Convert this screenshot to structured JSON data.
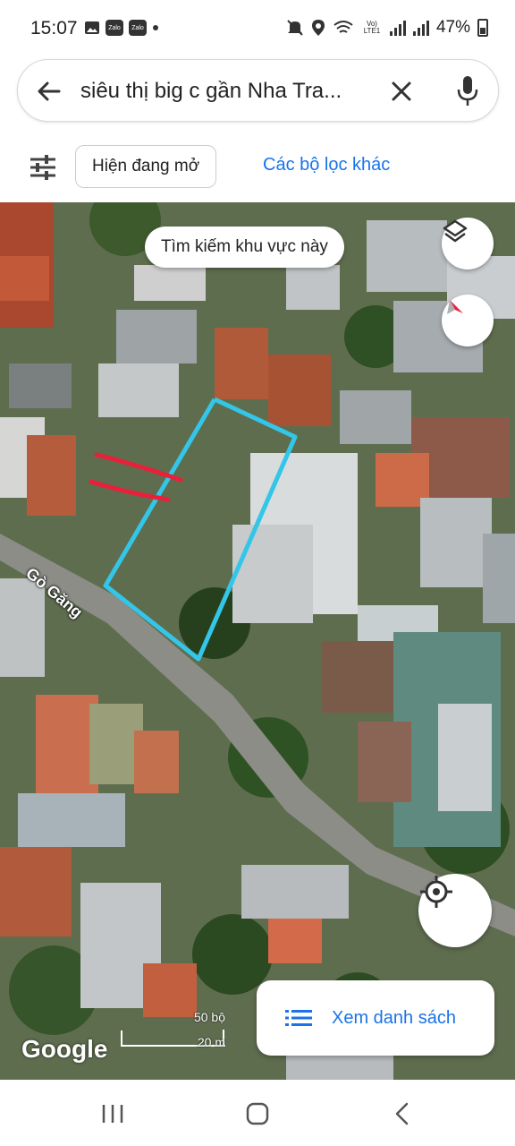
{
  "status": {
    "time": "15:07",
    "left_icons": [
      "image-icon",
      "zalo-icon",
      "zalo-icon",
      "dot-icon"
    ],
    "zalo_text": "Zalo",
    "network": "Vo) LTE1",
    "battery": "47%"
  },
  "search": {
    "query": "siêu thị big c gần Nha Tra...",
    "back_icon": "arrow-back-icon",
    "clear_icon": "close-icon",
    "mic_icon": "mic-icon"
  },
  "filters": {
    "icon": "tune-icon",
    "chip_open_now": "Hiện đang mở",
    "more_filters": "Các bộ lọc khác"
  },
  "map": {
    "search_area_button": "Tìm kiếm khu vực này",
    "street_label": "Gò Găng",
    "google_logo": "Google",
    "scale_top": "50 bộ",
    "scale_bottom": "20 m",
    "list_button": "Xem danh sách",
    "outline_color": "#33c6e8",
    "marker_color": "#e8203a"
  },
  "nav": {
    "recents": "recents-icon",
    "home": "home-icon",
    "back": "back-icon"
  }
}
